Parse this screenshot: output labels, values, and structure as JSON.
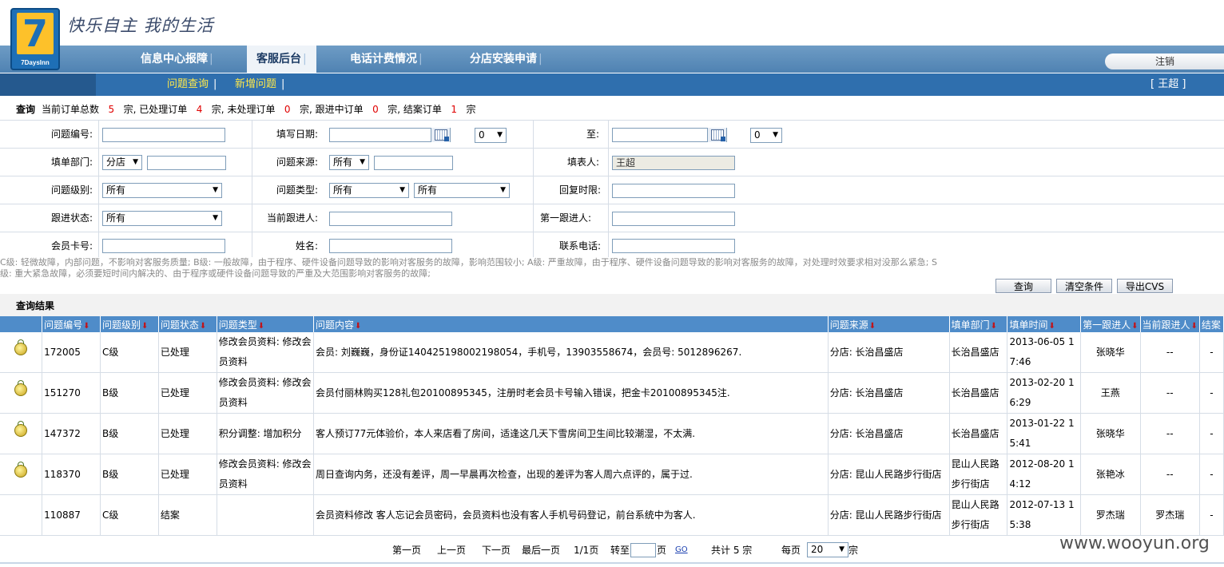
{
  "header": {
    "logo_text": "7",
    "logo_brand": "7DaysInn",
    "slogan": "快乐自主 我的生活",
    "nav": [
      {
        "label": "信息中心报障"
      },
      {
        "label": "客服后台"
      },
      {
        "label": "电话计费情况"
      },
      {
        "label": "分店安装申请"
      }
    ],
    "logout": "注销"
  },
  "subnav": {
    "items": [
      {
        "label": "问题查询"
      },
      {
        "label": "新增问题"
      }
    ],
    "user": "[ 王超 ]"
  },
  "summary": {
    "query_label": "查询",
    "total_prefix": "当前订单总数",
    "total": "5",
    "unit": "宗,",
    "processed_label": "已处理订单",
    "processed": "4",
    "unprocessed_label": "未处理订单",
    "unprocessed": "0",
    "following_label": "跟进中订单",
    "following": "0",
    "closed_label": "结案订单",
    "closed": "1",
    "unit_last": "宗"
  },
  "form": {
    "issue_no_label": "问题编号:",
    "fill_date_label": "填写日期:",
    "hour_value": "0",
    "to_label": "至:",
    "hour2_value": "0",
    "dept_label": "填单部门:",
    "dept_value": "分店",
    "source_label": "问题来源:",
    "source_value": "所有",
    "filler_label": "填表人:",
    "filler_value": "王超",
    "level_label": "问题级别:",
    "level_value": "所有",
    "type_label": "问题类型:",
    "type_value1": "所有",
    "type_value2": "所有",
    "reply_label": "回复时限:",
    "status_label": "跟进状态:",
    "status_value": "所有",
    "current_follow_label": "当前跟进人:",
    "first_follow_label": "第一跟进人:",
    "card_label": "会员卡号:",
    "name_label": "姓名:",
    "phone_label": "联系电话:"
  },
  "note": {
    "line1": "C级: 轻微故障，内部问题，不影响对客服务质量; B级: 一般故障，由于程序、硬件设备问题导致的影响对客服务的故障，影响范围较小; A级: 严重故障，由于程序、硬件设备问题导致的影响对客服务的故障，对处理时效要求相对没那么紧急; S",
    "line2": "级: 重大紧急故障，必须要短时间内解决的、由于程序或硬件设备问题导致的严重及大范围影响对客服务的故障;"
  },
  "buttons": {
    "query": "查询",
    "clear": "清空条件",
    "export": "导出CVS"
  },
  "results": {
    "title": "查询结果",
    "columns": [
      "问题编号",
      "问题级别",
      "问题状态",
      "问题类型",
      "问题内容",
      "问题来源",
      "填单部门",
      "填单时间",
      "第一跟进人",
      "当前跟进人",
      "结案"
    ],
    "rows": [
      {
        "id": "172005",
        "level": "C级",
        "status": "已处理",
        "type": "修改会员资料: 修改会员资料",
        "content": "会员: 刘巍巍，身份证140425198002198054，手机号，13903558674，会员号: 5012896267.",
        "source": "分店: 长治昌盛店",
        "dept": "长治昌盛店",
        "time": "2013-06-05 17:46",
        "first": "张晓华",
        "current": "--",
        "closed": "-"
      },
      {
        "id": "151270",
        "level": "B级",
        "status": "已处理",
        "type": "修改会员资料: 修改会员资料",
        "content": "会员付丽林购买128礼包20100895345，注册时老会员卡号输入错误，把金卡20100895345注.",
        "source": "分店: 长治昌盛店",
        "dept": "长治昌盛店",
        "time": "2013-02-20 16:29",
        "first": "王燕",
        "current": "--",
        "closed": "-"
      },
      {
        "id": "147372",
        "level": "B级",
        "status": "已处理",
        "type": "积分调整: 增加积分",
        "content": "客人预订77元体验价，本人来店看了房间，适逢这几天下雪房间卫生间比较潮湿，不太满.",
        "source": "分店: 长治昌盛店",
        "dept": "长治昌盛店",
        "time": "2013-01-22 15:41",
        "first": "张晓华",
        "current": "--",
        "closed": "-"
      },
      {
        "id": "118370",
        "level": "B级",
        "status": "已处理",
        "type": "修改会员资料: 修改会员资料",
        "content": "周日查询内务，还没有差评，周一早晨再次检查，出现的差评为客人周六点评的，属于过.",
        "source": "分店: 昆山人民路步行街店",
        "dept": "昆山人民路步行街店",
        "time": "2012-08-20 14:12",
        "first": "张艳冰",
        "current": "--",
        "closed": "-"
      },
      {
        "id": "110887",
        "level": "C级",
        "status": "结案",
        "type": "",
        "content": "会员资料修改 客人忘记会员密码，会员资料也没有客人手机号码登记，前台系统中为客人.",
        "source": "分店: 昆山人民路步行街店",
        "dept": "昆山人民路步行街店",
        "time": "2012-07-13 15:38",
        "first": "罗杰瑞",
        "current": "罗杰瑞",
        "closed": "-"
      }
    ]
  },
  "pager": {
    "first": "第一页",
    "prev": "上一页",
    "next": "下一页",
    "last": "最后一页",
    "page_info": "1/1页",
    "goto_label": "转至",
    "page_unit": "页",
    "go": "GO",
    "total": "共计 5 宗",
    "per_page_label": "每页",
    "per_page": "20",
    "per_page_unit": "宗"
  },
  "watermark": "www.wooyun.org"
}
